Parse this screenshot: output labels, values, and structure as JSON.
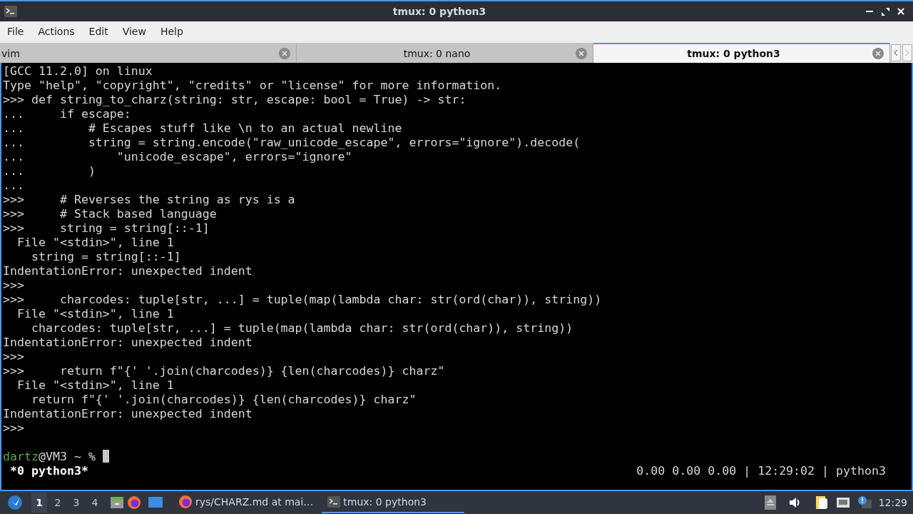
{
  "window": {
    "title": "tmux: 0 python3"
  },
  "menu": [
    "File",
    "Actions",
    "Edit",
    "View",
    "Help"
  ],
  "tabs": [
    {
      "label": "vim",
      "selected": false
    },
    {
      "label": "tmux: 0 nano",
      "selected": false
    },
    {
      "label": "tmux: 0 python3",
      "selected": true
    }
  ],
  "terminal": {
    "lines": [
      "[GCC 11.2.0] on linux",
      "Type \"help\", \"copyright\", \"credits\" or \"license\" for more information.",
      ">>> def string_to_charz(string: str, escape: bool = True) -> str:",
      "...     if escape:",
      "...         # Escapes stuff like \\n to an actual newline",
      "...         string = string.encode(\"raw_unicode_escape\", errors=\"ignore\").decode(",
      "...             \"unicode_escape\", errors=\"ignore\"",
      "...         )",
      "...",
      ">>>     # Reverses the string as rys is a",
      ">>>     # Stack based language",
      ">>>     string = string[::-1]",
      "  File \"<stdin>\", line 1",
      "    string = string[::-1]",
      "IndentationError: unexpected indent",
      ">>>",
      ">>>     charcodes: tuple[str, ...] = tuple(map(lambda char: str(ord(char)), string))",
      "  File \"<stdin>\", line 1",
      "    charcodes: tuple[str, ...] = tuple(map(lambda char: str(ord(char)), string))",
      "IndentationError: unexpected indent",
      ">>>",
      ">>>     return f\"{' '.join(charcodes)} {len(charcodes)} charz\"",
      "  File \"<stdin>\", line 1",
      "    return f\"{' '.join(charcodes)} {len(charcodes)} charz\"",
      "IndentationError: unexpected indent",
      ">>>"
    ],
    "prompt": {
      "user": "dartz",
      "rest": "@VM3 ~ %"
    }
  },
  "tmux_status": {
    "window": "*0 python3*",
    "right": "0.00 0.00 0.00 | 12:29:02 | python3"
  },
  "taskbar": {
    "workspaces": [
      {
        "label": "1",
        "selected": true
      },
      {
        "label": "2",
        "selected": false
      },
      {
        "label": "3",
        "selected": false
      },
      {
        "label": "4",
        "selected": false
      }
    ],
    "tasks": [
      {
        "label": "rys/CHARZ.md at mai…",
        "kind": "browser",
        "selected": false
      },
      {
        "label": "tmux: 0 python3",
        "kind": "terminal",
        "selected": true
      }
    ],
    "clock": "12:29"
  }
}
